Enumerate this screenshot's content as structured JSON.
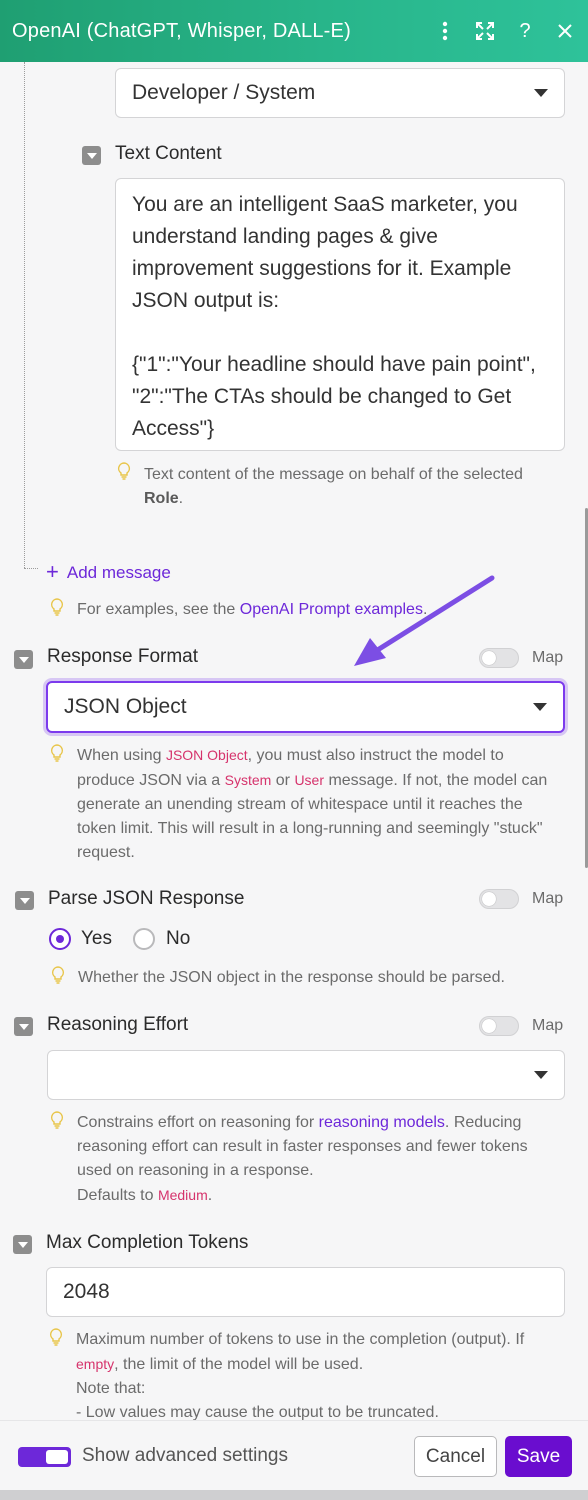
{
  "header": {
    "title": "OpenAI (ChatGPT, Whisper, DALL-E)",
    "icons": [
      "more-vertical-icon",
      "expand-icon",
      "help-icon",
      "close-icon"
    ],
    "background": "#22a97c"
  },
  "message": {
    "role_value": "Developer / System",
    "text_content_label": "Text Content",
    "text_content_value": "You are an intelligent SaaS marketer, you understand landing pages & give improvement suggestions for it. Example JSON output is:\n\n{\"1\":\"Your headline should have pain point\", \"2\":\"The CTAs should be changed to Get Access\"}",
    "hint_prefix": "Text content of the message on behalf of the selected ",
    "hint_bold": "Role",
    "hint_suffix": "."
  },
  "add_message": {
    "label": "Add message"
  },
  "examples_hint": {
    "prefix": "For examples, see the ",
    "link": "OpenAI Prompt examples",
    "suffix": "."
  },
  "response_format": {
    "label": "Response Format",
    "map_label": "Map",
    "value": "JSON Object",
    "hint_1": "When using ",
    "hint_code_1": "JSON Object",
    "hint_2": ", you must also instruct the model to produce JSON via a ",
    "hint_code_2": "System",
    "hint_3": " or ",
    "hint_code_3": "User",
    "hint_4": " message. If not, the model can generate an unending stream of whitespace until it reaches the token limit. This will result in a long-running and seemingly \"stuck\" request."
  },
  "parse_json": {
    "label": "Parse JSON Response",
    "map_label": "Map",
    "option_yes": "Yes",
    "option_no": "No",
    "selected": "Yes",
    "hint": "Whether the JSON object in the response should be parsed."
  },
  "reasoning_effort": {
    "label": "Reasoning Effort",
    "map_label": "Map",
    "value": "",
    "hint_1": "Constrains effort on reasoning for ",
    "hint_link": "reasoning models",
    "hint_2": ". Reducing reasoning effort can result in faster responses and fewer tokens used on reasoning in a response.",
    "defaults_prefix": "Defaults to ",
    "defaults_code": "Medium",
    "defaults_suffix": "."
  },
  "max_tokens": {
    "label": "Max Completion Tokens",
    "value": "2048",
    "hint_1": "Maximum number of tokens to use in the completion (output). If ",
    "hint_code": "empty",
    "hint_2": ", the limit of the model will be used.",
    "note": "Note that:",
    "bullet": "- Low values may cause the output to be truncated."
  },
  "footer": {
    "advanced_label": "Show advanced settings",
    "cancel_label": "Cancel",
    "save_label": "Save",
    "accent": "#6a0dcf"
  }
}
